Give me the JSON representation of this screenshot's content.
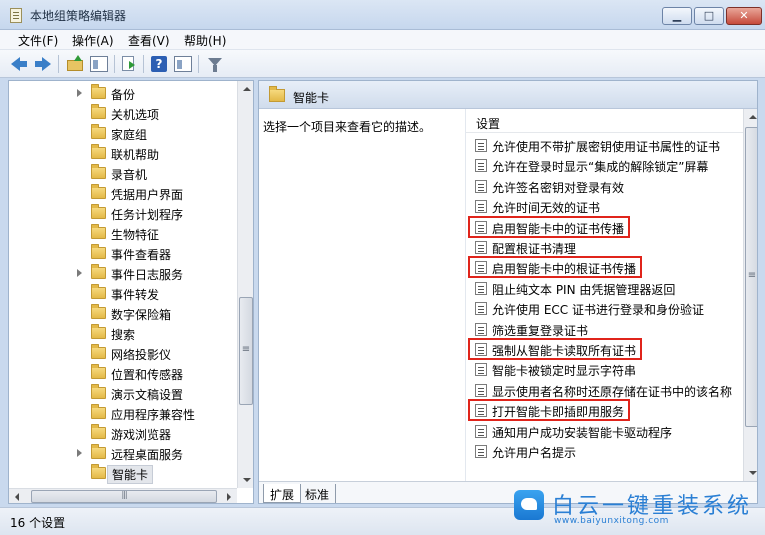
{
  "window": {
    "title": "本地组策略编辑器"
  },
  "menu": [
    "文件(F)",
    "操作(A)",
    "查看(V)",
    "帮助(H)"
  ],
  "tree": {
    "items": [
      {
        "label": "备份",
        "expandable": true
      },
      {
        "label": "关机选项",
        "expandable": false
      },
      {
        "label": "家庭组",
        "expandable": false
      },
      {
        "label": "联机帮助",
        "expandable": false
      },
      {
        "label": "录音机",
        "expandable": false
      },
      {
        "label": "凭据用户界面",
        "expandable": false
      },
      {
        "label": "任务计划程序",
        "expandable": false
      },
      {
        "label": "生物特征",
        "expandable": false
      },
      {
        "label": "事件查看器",
        "expandable": false
      },
      {
        "label": "事件日志服务",
        "expandable": true
      },
      {
        "label": "事件转发",
        "expandable": false
      },
      {
        "label": "数字保险箱",
        "expandable": false
      },
      {
        "label": "搜索",
        "expandable": false
      },
      {
        "label": "网络投影仪",
        "expandable": false
      },
      {
        "label": "位置和传感器",
        "expandable": false
      },
      {
        "label": "演示文稿设置",
        "expandable": false
      },
      {
        "label": "应用程序兼容性",
        "expandable": false
      },
      {
        "label": "游戏浏览器",
        "expandable": false
      },
      {
        "label": "远程桌面服务",
        "expandable": true
      },
      {
        "label": "智能卡",
        "expandable": false,
        "selected": true
      }
    ]
  },
  "right": {
    "header_title": "智能卡",
    "description": "选择一个项目来查看它的描述。",
    "column_header": "设置",
    "settings": [
      {
        "label": "允许使用不带扩展密钥使用证书属性的证书",
        "highlight": false
      },
      {
        "label": "允许在登录时显示“集成的解除锁定”屏幕",
        "highlight": false
      },
      {
        "label": "允许签名密钥对登录有效",
        "highlight": false
      },
      {
        "label": "允许时间无效的证书",
        "highlight": false
      },
      {
        "label": "启用智能卡中的证书传播",
        "highlight": true
      },
      {
        "label": "配置根证书清理",
        "highlight": false
      },
      {
        "label": "启用智能卡中的根证书传播",
        "highlight": true
      },
      {
        "label": "阻止纯文本 PIN 由凭据管理器返回",
        "highlight": false
      },
      {
        "label": "允许使用 ECC 证书进行登录和身份验证",
        "highlight": false
      },
      {
        "label": "筛选重复登录证书",
        "highlight": false
      },
      {
        "label": "强制从智能卡读取所有证书",
        "highlight": true
      },
      {
        "label": "智能卡被锁定时显示字符串",
        "highlight": false
      },
      {
        "label": "显示使用者名称时还原存储在证书中的该名称",
        "highlight": false
      },
      {
        "label": "打开智能卡即插即用服务",
        "highlight": true
      },
      {
        "label": "通知用户成功安装智能卡驱动程序",
        "highlight": false
      },
      {
        "label": "允许用户名提示",
        "highlight": false
      }
    ],
    "tabs": [
      "扩展",
      "标准"
    ]
  },
  "status": {
    "text": "16 个设置"
  },
  "watermark": {
    "main": "白云一键重装系统",
    "sub": "www.baiyunxitong.com"
  },
  "colors": {
    "highlight_border": "#e0241b",
    "accent": "#2a7fd4"
  }
}
